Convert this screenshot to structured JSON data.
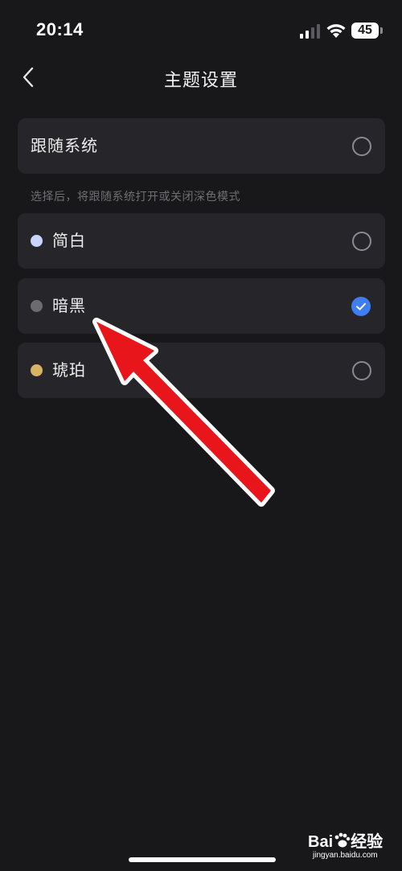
{
  "status_bar": {
    "time": "20:14",
    "battery": "45",
    "icons": [
      "signal-icon",
      "wifi-icon",
      "battery-icon"
    ]
  },
  "header": {
    "back_icon": "chevron-left-icon",
    "title": "主题设置"
  },
  "follow_system": {
    "label": "跟随系统",
    "checked": false,
    "hint": "选择后，将跟随系统打开或关闭深色模式"
  },
  "themes": [
    {
      "label": "简白",
      "dot_color": "#c9d4ff",
      "checked": false
    },
    {
      "label": "暗黑",
      "dot_color": "#6b6b70",
      "checked": true
    },
    {
      "label": "琥珀",
      "dot_color": "#d6b463",
      "checked": false
    }
  ],
  "colors": {
    "background": "#18181b",
    "card": "#25252a",
    "accent": "#3f7ef2",
    "annotation_arrow": "#e8151b"
  },
  "watermark": {
    "brand": "Bai",
    "brand_suffix": "经验",
    "url": "jingyan.baidu.com"
  }
}
